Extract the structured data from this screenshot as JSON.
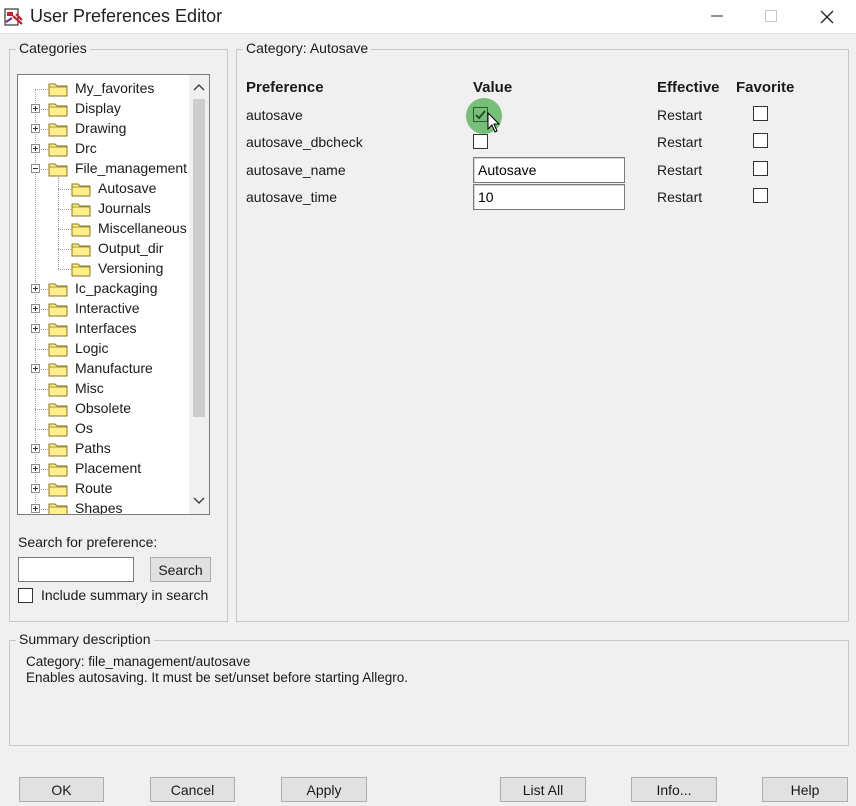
{
  "window": {
    "title": "User Preferences Editor"
  },
  "categories_panel": {
    "label": "Categories",
    "tree": [
      {
        "label": "My_favorites",
        "level": 0,
        "expander": "none"
      },
      {
        "label": "Display",
        "level": 0,
        "expander": "plus"
      },
      {
        "label": "Drawing",
        "level": 0,
        "expander": "plus"
      },
      {
        "label": "Drc",
        "level": 0,
        "expander": "plus"
      },
      {
        "label": "File_management",
        "level": 0,
        "expander": "minus"
      },
      {
        "label": "Autosave",
        "level": 1,
        "expander": "none"
      },
      {
        "label": "Journals",
        "level": 1,
        "expander": "none"
      },
      {
        "label": "Miscellaneous",
        "level": 1,
        "expander": "none"
      },
      {
        "label": "Output_dir",
        "level": 1,
        "expander": "none"
      },
      {
        "label": "Versioning",
        "level": 1,
        "expander": "none"
      },
      {
        "label": "Ic_packaging",
        "level": 0,
        "expander": "plus"
      },
      {
        "label": "Interactive",
        "level": 0,
        "expander": "plus"
      },
      {
        "label": "Interfaces",
        "level": 0,
        "expander": "plus"
      },
      {
        "label": "Logic",
        "level": 0,
        "expander": "none"
      },
      {
        "label": "Manufacture",
        "level": 0,
        "expander": "plus"
      },
      {
        "label": "Misc",
        "level": 0,
        "expander": "none"
      },
      {
        "label": "Obsolete",
        "level": 0,
        "expander": "none"
      },
      {
        "label": "Os",
        "level": 0,
        "expander": "none"
      },
      {
        "label": "Paths",
        "level": 0,
        "expander": "plus"
      },
      {
        "label": "Placement",
        "level": 0,
        "expander": "plus"
      },
      {
        "label": "Route",
        "level": 0,
        "expander": "plus"
      },
      {
        "label": "Shapes",
        "level": 0,
        "expander": "plus"
      }
    ],
    "search_label": "Search for preference:",
    "search_value": "",
    "search_button": "Search",
    "include_summary_label": "Include summary in search"
  },
  "category_panel": {
    "label": "Category:  Autosave",
    "columns": {
      "preference": "Preference",
      "value": "Value",
      "effective": "Effective",
      "favorite": "Favorite"
    },
    "rows": [
      {
        "name": "autosave",
        "type": "checkbox",
        "checked": true,
        "effective": "Restart",
        "favorite": false
      },
      {
        "name": "autosave_dbcheck",
        "type": "checkbox",
        "checked": false,
        "effective": "Restart",
        "favorite": false
      },
      {
        "name": "autosave_name",
        "type": "text",
        "value": "Autosave",
        "effective": "Restart",
        "favorite": false
      },
      {
        "name": "autosave_time",
        "type": "text",
        "value": "10",
        "effective": "Restart",
        "favorite": false
      }
    ]
  },
  "summary": {
    "label": "Summary description",
    "line1": "Category: file_management/autosave",
    "line2": "Enables autosaving. It must be set/unset before starting Allegro."
  },
  "buttons": {
    "ok": "OK",
    "cancel": "Cancel",
    "apply": "Apply",
    "list_all": "List All",
    "info": "Info...",
    "help": "Help"
  },
  "colors": {
    "folder_fill": "#ffef8a",
    "folder_stroke": "#8a7a20",
    "highlight": "#4caf50"
  }
}
